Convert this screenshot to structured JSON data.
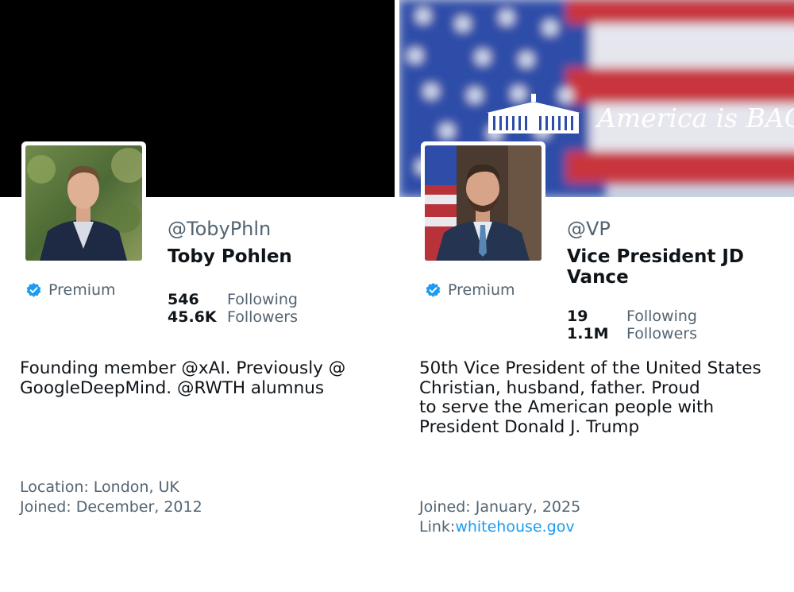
{
  "profiles": [
    {
      "handle": "@TobyPhln",
      "name": "Toby Pohlen",
      "badge": "Premium",
      "following_count": "546",
      "following_label": "Following",
      "followers_count": "45.6K",
      "followers_label": "Followers",
      "bio": "Founding member @xAI. Previously @\nGoogleDeepMind. @RWTH alumnus",
      "location": "Location: London, UK",
      "joined": "Joined: December, 2012",
      "banner_color": "#000000"
    },
    {
      "handle": "@VP",
      "name": "Vice President JD Vance",
      "badge": "Premium",
      "following_count": "19",
      "following_label": "Following",
      "followers_count": "1.1M",
      "followers_label": "Followers",
      "bio": "50th Vice President of the United States\nChristian, husband, father. Proud\nto serve the American people with\nPresident Donald J. Trump",
      "joined": "Joined: January, 2025",
      "link_label": "Link:",
      "link_value": "whitehouse.gov",
      "banner_text": "America is BACK."
    }
  ],
  "colors": {
    "verified_blue": "#1d9bf0",
    "secondary_text": "#536471",
    "primary_text": "#0f1419",
    "link": "#1d9bf0"
  },
  "icons": {
    "verified": "verified-badge-icon",
    "white_house": "white-house-icon"
  }
}
